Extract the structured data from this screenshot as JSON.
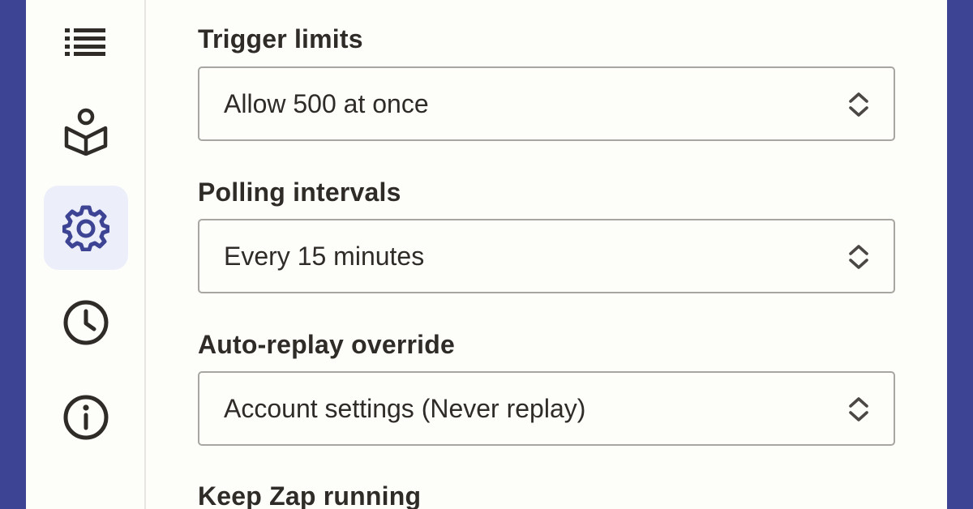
{
  "sidebar": {
    "items": [
      {
        "icon": "list-icon",
        "active": false
      },
      {
        "icon": "book-reader-icon",
        "active": false
      },
      {
        "icon": "gear-icon",
        "active": true
      },
      {
        "icon": "clock-icon",
        "active": false
      },
      {
        "icon": "info-icon",
        "active": false
      }
    ]
  },
  "settings": {
    "trigger_limits": {
      "label": "Trigger limits",
      "value": "Allow 500 at once"
    },
    "polling_intervals": {
      "label": "Polling intervals",
      "value": "Every 15 minutes"
    },
    "auto_replay_override": {
      "label": "Auto-replay override",
      "value": "Account settings (Never replay)"
    },
    "keep_zap_running": {
      "label": "Keep Zap running"
    }
  },
  "colors": {
    "background": "#3d4494",
    "panel": "#fdfdf9",
    "text": "#2f2c28",
    "accent": "#3d4494",
    "active_bg": "#eceef9",
    "border": "#a8a6a0"
  }
}
